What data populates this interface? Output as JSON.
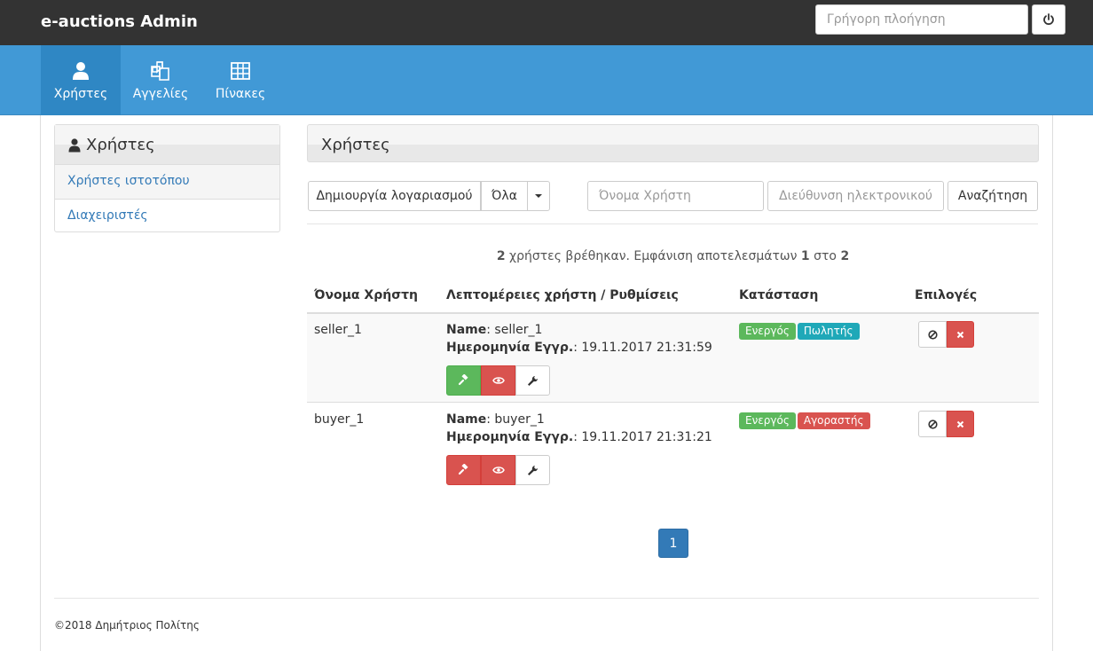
{
  "app": {
    "brand": "e-auctions Admin"
  },
  "topbar": {
    "quick_search_placeholder": "Γρήγορη πλοήγηση"
  },
  "menu": {
    "items": [
      {
        "label": "Χρήστες",
        "icon": "user-icon",
        "active": true
      },
      {
        "label": "Αγγελίες",
        "icon": "copy-icon",
        "active": false
      },
      {
        "label": "Πίνακες",
        "icon": "table-icon",
        "active": false
      }
    ]
  },
  "sidebar": {
    "title": "Χρήστες",
    "items": [
      {
        "label": "Χρήστες ιστοτόπου",
        "selected": true
      },
      {
        "label": "Διαχειριστές",
        "selected": false
      }
    ]
  },
  "main": {
    "title": "Χρήστες",
    "toolbar": {
      "create_label": "Δημιουργία λογαριασμού",
      "filter_label": "Όλα",
      "username_placeholder": "Όνομα Χρήστη",
      "email_placeholder": "Διεύθυνση ηλεκτρονικού ταχυδρομείου",
      "search_label": "Αναζήτηση"
    },
    "results": {
      "count": "2",
      "text1": " χρήστες βρέθηκαν. Εμφάνιση αποτελεσμάτων ",
      "from": "1",
      "text2": " στο ",
      "to": "2"
    },
    "table": {
      "headers": [
        "Όνομα Χρήστη",
        "Λεπτομέρειες χρήστη / Ρυθμίσεις",
        "Κατάσταση",
        "Επιλογές"
      ],
      "name_label": "Name",
      "date_label": "Ημερομηνία Εγγρ.",
      "rows": [
        {
          "username": "seller_1",
          "name": ": seller_1",
          "date": ": 19.11.2017 21:31:59",
          "status": "Ενεργός",
          "role": "Πωλητής",
          "role_color": "#1fa8b8",
          "gavel_color": "#5cb85c"
        },
        {
          "username": "buyer_1",
          "name": ": buyer_1",
          "date": ": 19.11.2017 21:31:21",
          "status": "Ενεργός",
          "role": "Αγοραστής",
          "role_color": "#d9534f",
          "gavel_color": "#d9534f"
        }
      ]
    },
    "pagination": {
      "current": "1"
    }
  },
  "footer": {
    "text": "©2018 Δημήτριος Πολίτης"
  }
}
